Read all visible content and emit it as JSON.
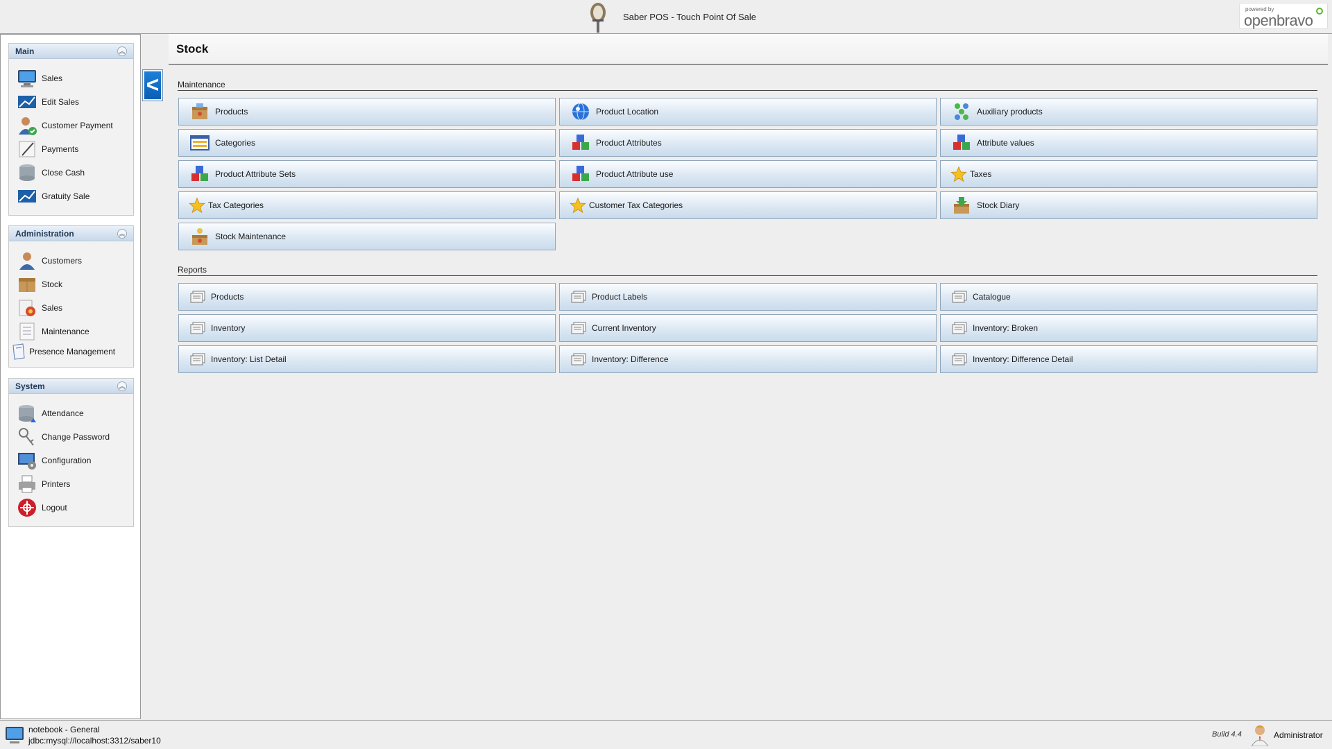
{
  "app": {
    "title": "Saber POS - Touch Point Of Sale",
    "brand_small": "powered by",
    "brand_name": "openbravo"
  },
  "sidebar": {
    "sections": [
      {
        "title": "Main",
        "items": [
          "Sales",
          "Edit Sales",
          "Customer Payment",
          "Payments",
          "Close Cash",
          "Gratuity Sale"
        ]
      },
      {
        "title": "Administration",
        "items": [
          "Customers",
          "Stock",
          "Sales",
          "Maintenance",
          "Presence Management"
        ]
      },
      {
        "title": "System",
        "items": [
          "Attendance",
          "Change Password",
          "Configuration",
          "Printers",
          "Logout"
        ]
      }
    ],
    "collapse_label": "<"
  },
  "main": {
    "title": "Stock",
    "maintenance_label": "Maintenance",
    "maintenance": [
      "Products",
      "Product Location",
      "Auxiliary products",
      "Categories",
      "Product Attributes",
      "Attribute values",
      "Product Attribute Sets",
      "Product Attribute use",
      "Taxes",
      "Tax Categories",
      "Customer Tax Categories",
      "Stock Diary",
      "Stock Maintenance"
    ],
    "reports_label": "Reports",
    "reports": [
      "Products",
      "Product Labels",
      "Catalogue",
      "Inventory",
      "Current Inventory",
      "Inventory: Broken",
      "Inventory: List Detail",
      "Inventory: Difference",
      "Inventory: Difference Detail"
    ]
  },
  "status": {
    "host": "notebook - General",
    "connection": "jdbc:mysql://localhost:3312/saber10",
    "build": "Build 4.4",
    "user": "Administrator"
  },
  "colors": {
    "accent": "#0a5fb4",
    "tile_border": "#8fa6bc",
    "brand_green": "#5bb533"
  }
}
